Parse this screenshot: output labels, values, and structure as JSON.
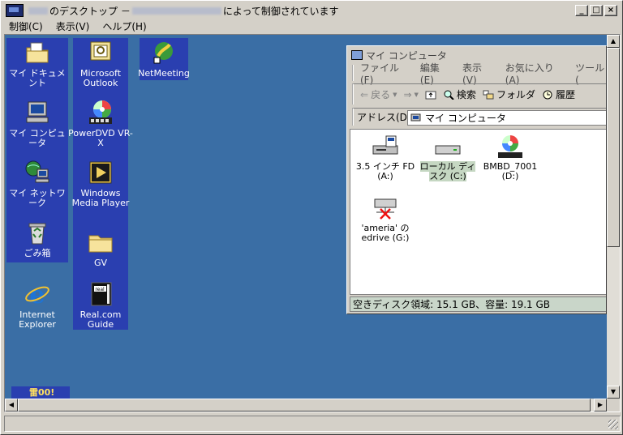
{
  "window": {
    "title_prefix": "のデスクトップ －",
    "title_suffix": "によって制御されています",
    "buttons": [
      "_",
      "□",
      "×"
    ]
  },
  "menubar": [
    "制御(C)",
    "表示(V)",
    "ヘルプ(H)"
  ],
  "desktop_icons": [
    {
      "label": "マイ ドキュメント",
      "icon": "folder-documents-icon"
    },
    {
      "label": "マイ コンピュータ",
      "icon": "computer-icon"
    },
    {
      "label": "マイ ネットワーク",
      "icon": "network-icon"
    },
    {
      "label": "ごみ箱",
      "icon": "recycle-bin-icon"
    },
    {
      "label": "Internet Explorer",
      "icon": "internet-explorer-icon"
    },
    {
      "label": "Microsoft Outlook",
      "icon": "outlook-icon"
    },
    {
      "label": "PowerDVD VR-X",
      "icon": "powerdvd-icon"
    },
    {
      "label": "Windows Media Player",
      "icon": "media-player-icon"
    },
    {
      "label": "GV",
      "icon": "folder-icon"
    },
    {
      "label": "Real.com Guide",
      "icon": "real-icon"
    },
    {
      "label": "NetMeeting",
      "icon": "netmeeting-icon"
    }
  ],
  "tray_text": "雷00!",
  "explorer": {
    "title": "マイ コンピュータ",
    "menu": [
      "ファイル(F)",
      "編集(E)",
      "表示(V)",
      "お気に入り(A)",
      "ツール("
    ],
    "toolbar": {
      "back": "戻る",
      "search": "検索",
      "folders": "フォルダ",
      "history": "履歴"
    },
    "address_label": "アドレス(D)",
    "address_value": "マイ コンピュータ",
    "drives": [
      {
        "label": "3.5 インチ FD (A:)",
        "icon": "floppy-drive-icon"
      },
      {
        "label": "ローカル ディスク (C:)",
        "icon": "local-disk-icon"
      },
      {
        "label": "BMBD_7001 (D:)",
        "icon": "cd-drive-icon"
      },
      {
        "label": "'ameria' の edrive (G:)",
        "icon": "network-drive-disconnected-icon"
      }
    ],
    "status": "空きディスク領域: 15.1 GB、容量: 19.1 GB"
  }
}
